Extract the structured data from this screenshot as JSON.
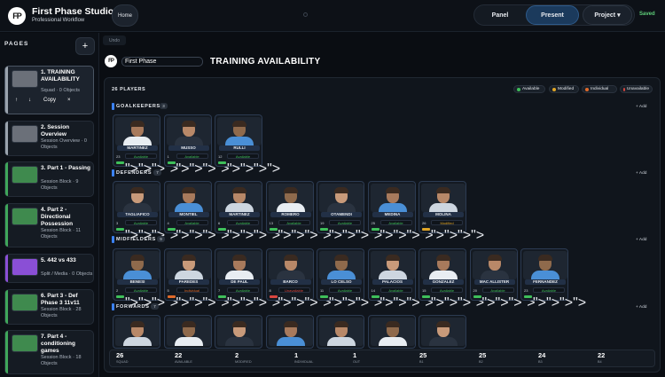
{
  "app": {
    "title": "First Phase Studio",
    "subtitle": "Professional Workflow",
    "logo_text": "FP"
  },
  "nav": {
    "home": "Home",
    "panel": "Panel",
    "present": "Present",
    "project": "Project ▾",
    "saved": "Saved"
  },
  "sidebar": {
    "heading": "PAGES",
    "add": "+",
    "controls": {
      "up": "↑",
      "down": "↓",
      "copy": "Copy",
      "close": "×"
    },
    "pages": [
      {
        "title": "1. TRAINING AVAILABILITY",
        "meta": "Squad · 0 Objects",
        "thumb": "#6b7079",
        "accent": "#9aa3ad"
      },
      {
        "title": "2. Session Overview",
        "meta": "Session Overview · 0 Objects",
        "thumb": "#6b7079",
        "accent": "#9aa3ad"
      },
      {
        "title": "3. Part 1 - Passing",
        "meta": "Session Block · 9 Objects",
        "thumb": "#3f8a4e",
        "accent": "#3fa65a"
      },
      {
        "title": "4. Part 2 - Directional Possession",
        "meta": "Session Block · 11 Objects",
        "thumb": "#3f8a4e",
        "accent": "#3fa65a"
      },
      {
        "title": "5. 442 vs 433",
        "meta": "Split / Media · 0 Objects",
        "thumb": "#8a4fd6",
        "accent": "#8a4fd6"
      },
      {
        "title": "6. Part 3 - Def Phase 3 11v11",
        "meta": "Session Block · 28 Objects",
        "thumb": "#3f8a4e",
        "accent": "#3fa65a"
      },
      {
        "title": "7. Part 4 - conditioning games",
        "meta": "Session Block · 18 Objects",
        "thumb": "#3f8a4e",
        "accent": "#3fa65a"
      }
    ]
  },
  "editor": {
    "undo": "Undo",
    "page_name": "First Phase",
    "page_title": "TRAINING AVAILABILITY"
  },
  "board": {
    "players_count": "26 PLAYERS",
    "legend": [
      {
        "label": "Available",
        "color": "#3fbf5a"
      },
      {
        "label": "Modified",
        "color": "#e0a526"
      },
      {
        "label": "Individual",
        "color": "#e06a2a"
      },
      {
        "label": "Unavailable",
        "color": "#d9463f"
      }
    ],
    "add_label": "+ Add",
    "sections": [
      {
        "title": "GOALKEEPERS",
        "count": "3",
        "players": [
          {
            "name": "MARTINEZ",
            "num": "23",
            "status": "Available",
            "color": "#3fbf5a"
          },
          {
            "name": "MUSSO",
            "num": "1",
            "status": "Available",
            "color": "#3fbf5a"
          },
          {
            "name": "RULLI",
            "num": "12",
            "status": "Available",
            "color": "#3fbf5a"
          }
        ]
      },
      {
        "title": "DEFENDERS",
        "count": "7",
        "players": [
          {
            "name": "TAGLIAFICO",
            "num": "3",
            "status": "Available",
            "color": "#3fbf5a"
          },
          {
            "name": "MONTIEL",
            "num": "4",
            "status": "Available",
            "color": "#3fbf5a"
          },
          {
            "name": "MARTINEZ",
            "num": "6",
            "status": "Available",
            "color": "#3fbf5a"
          },
          {
            "name": "ROMERO",
            "num": "13",
            "status": "Available",
            "color": "#3fbf5a"
          },
          {
            "name": "OTAMENDI",
            "num": "19",
            "status": "Available",
            "color": "#3fbf5a"
          },
          {
            "name": "MEDINA",
            "num": "25",
            "status": "Available",
            "color": "#3fbf5a"
          },
          {
            "name": "MOLINA",
            "num": "26",
            "status": "Modified",
            "color": "#e0a526"
          }
        ]
      },
      {
        "title": "MIDFIELDERS",
        "count": "9",
        "players": [
          {
            "name": "BENESI",
            "num": "2",
            "status": "Available",
            "color": "#3fbf5a"
          },
          {
            "name": "PAREDES",
            "num": "5",
            "status": "Individual",
            "color": "#e06a2a"
          },
          {
            "name": "DE PAUL",
            "num": "7",
            "status": "Available",
            "color": "#3fbf5a"
          },
          {
            "name": "BARCO",
            "num": "8",
            "status": "Unavailable",
            "color": "#d9463f"
          },
          {
            "name": "LO CELSO",
            "num": "11",
            "status": "Available",
            "color": "#3fbf5a"
          },
          {
            "name": "PALACIOS",
            "num": "14",
            "status": "Available",
            "color": "#3fbf5a"
          },
          {
            "name": "GONZALEZ",
            "num": "15",
            "status": "Available",
            "color": "#3fbf5a"
          },
          {
            "name": "MAC ALLISTER",
            "num": "20",
            "status": "Available",
            "color": "#3fbf5a"
          },
          {
            "name": "FERNANDEZ",
            "num": "23",
            "status": "Available",
            "color": "#3fbf5a"
          }
        ]
      },
      {
        "title": "FORWARDS",
        "count": "7",
        "players": [
          {
            "name": "",
            "num": "",
            "status": "",
            "color": "#3fbf5a"
          },
          {
            "name": "",
            "num": "",
            "status": "",
            "color": "#3fbf5a"
          },
          {
            "name": "",
            "num": "",
            "status": "",
            "color": "#3fbf5a"
          },
          {
            "name": "",
            "num": "",
            "status": "",
            "color": "#3fbf5a"
          },
          {
            "name": "",
            "num": "",
            "status": "",
            "color": "#3fbf5a"
          },
          {
            "name": "",
            "num": "",
            "status": "",
            "color": "#3fbf5a"
          },
          {
            "name": "",
            "num": "",
            "status": "",
            "color": "#3fbf5a"
          }
        ]
      }
    ]
  },
  "stats": [
    {
      "value": "26",
      "label": "SQUAD"
    },
    {
      "value": "22",
      "label": "AVAILABLE"
    },
    {
      "value": "2",
      "label": "MODIFIED"
    },
    {
      "value": "1",
      "label": "INDIVIDUAL"
    },
    {
      "value": "1",
      "label": "OUT"
    },
    {
      "value": "25",
      "label": "B1"
    },
    {
      "value": "25",
      "label": "B2"
    },
    {
      "value": "24",
      "label": "B3"
    },
    {
      "value": "22",
      "label": "B4"
    }
  ]
}
